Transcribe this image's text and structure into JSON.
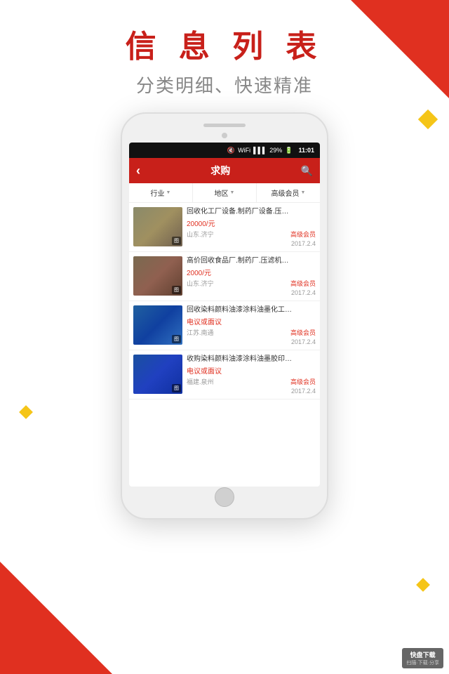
{
  "background": {
    "color": "#ffffff"
  },
  "header": {
    "main_title": "信 息 列 表",
    "sub_title": "分类明细、快速精准"
  },
  "phone": {
    "status_bar": {
      "battery": "29%",
      "time": "11:01",
      "signal_icon": "▶",
      "wifi_icon": "WiFi"
    },
    "app_header": {
      "back_label": "‹",
      "title": "求购",
      "search_icon": "🔍"
    },
    "filter_bar": {
      "items": [
        {
          "label": "行业",
          "arrow": "▼"
        },
        {
          "label": "地区",
          "arrow": "▼"
        },
        {
          "label": "高级会员",
          "arrow": "▼"
        }
      ]
    },
    "list_items": [
      {
        "title": "回收化工厂设备.制药厂设备.压…",
        "price": "20000/元",
        "location": "山东.济宁",
        "date": "2017.2.4",
        "vip": "高级会员",
        "img_class": "img-item1"
      },
      {
        "title": "高价回收食品厂.制药厂.压滤机…",
        "price": "2000/元",
        "location": "山东.济宁",
        "date": "2017.2.4",
        "vip": "高级会员",
        "img_class": "img-item2"
      },
      {
        "title": "回收染料颜料油漆涂料油墨化工…",
        "price": "电议或面议",
        "location": "江苏.南通",
        "date": "2017.2.4",
        "vip": "高级会员",
        "img_class": "img-item3"
      },
      {
        "title": "收购染料颜料油漆涂料油墨胶印…",
        "price": "电议或面议",
        "location": "福建.泉州",
        "date": "2017.2.4",
        "vip": "高级会员",
        "img_class": "img-item4"
      }
    ]
  },
  "watermark": {
    "logo": "快盘下载",
    "sub": "扫描·下载·分享"
  }
}
